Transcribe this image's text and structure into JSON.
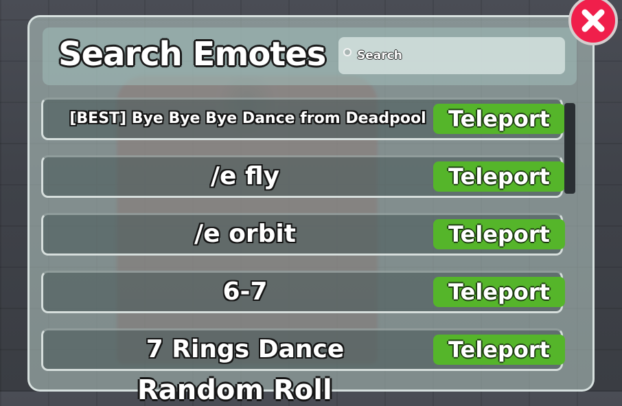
{
  "header": {
    "title": "Search Emotes",
    "search_placeholder": "Search"
  },
  "emotes": [
    {
      "label": "[BEST] Bye Bye Bye Dance from Deadpool",
      "button": "Teleport"
    },
    {
      "label": "/e fly",
      "button": "Teleport"
    },
    {
      "label": "/e orbit",
      "button": "Teleport"
    },
    {
      "label": "6-7",
      "button": "Teleport"
    },
    {
      "label": "7 Rings Dance",
      "button": "Teleport"
    }
  ],
  "overflow_label": "Random Roll",
  "icons": {
    "close": "close-icon",
    "search": "search-icon"
  },
  "colors": {
    "teleport_green": "#55b52a",
    "close_red": "#f01f4b"
  }
}
